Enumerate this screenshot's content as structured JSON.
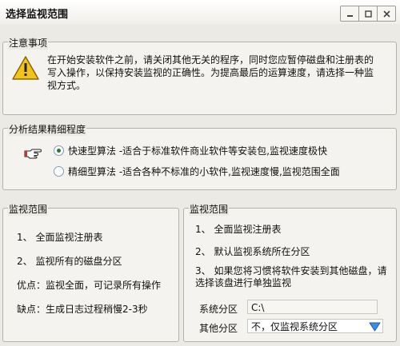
{
  "window": {
    "title": "选择监视范围"
  },
  "notice": {
    "label": "注意事项",
    "line1": "在开始安装软件之前，请关闭其他无关的程序，同时您应暂停磁盘和注册表的",
    "line2": "写入操作，以保持安装监视的正确性。为提高最后的运算速度，请选择一种监",
    "line3": "视方式。"
  },
  "precision": {
    "label": "分析结果精细程度",
    "options": [
      {
        "label": "快速型算法 -适合于标准软件商业软件等安装包,监视速度极快",
        "selected": true
      },
      {
        "label": "精细型算法 -适合各种不标准的小软件,监视速度慢,监视范围全面",
        "selected": false
      }
    ]
  },
  "scope_left": {
    "label": "监视范围",
    "item1": "1、 全面监视注册表",
    "item2": "2、 监视所有的磁盘分区",
    "pro": "优点：监视全面，可记录所有操作",
    "con": "缺点：生成日志过程稍慢2-3秒"
  },
  "scope_right": {
    "label": "监视范围",
    "item1": "1、 全面监视注册表",
    "item2": "2、 默认监视系统所在分区",
    "item3_line1": "3、 如果您将习惯将软件安装到其他磁盘，请",
    "item3_line2": "选择该盘进行单独监视",
    "system_partition_label": "系统分区",
    "system_partition_value": "C:\\",
    "other_partition_label": "其他分区",
    "other_partition_value": "不，仅监视系统分区"
  },
  "colors": {
    "warning_fill": "#f3c21e",
    "radio_dot": "#2a7a2a",
    "dropdown_arrow": "#3a8ee0"
  }
}
